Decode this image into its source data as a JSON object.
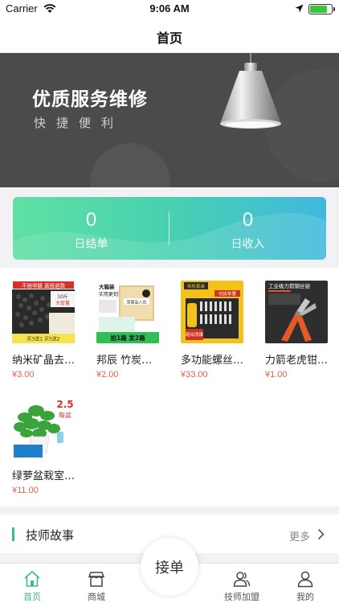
{
  "status_bar": {
    "carrier": "Carrier",
    "time": "9:06 AM",
    "battery_level": 0.85
  },
  "nav": {
    "title": "首页"
  },
  "banner": {
    "headline": "优质服务维修",
    "subline": "快捷便利"
  },
  "stats": {
    "daily_orders": {
      "value": "0",
      "label": "日结单"
    },
    "daily_income": {
      "value": "0",
      "label": "日收入"
    }
  },
  "products": [
    {
      "name": "纳米矿晶去…",
      "price": "¥3.00",
      "img_text": [
        "不除甲醛 直接退款",
        "10斤",
        "大促量",
        "买3送1 买5送2"
      ]
    },
    {
      "name": "邦辰 竹炭…",
      "price": "¥2.00",
      "img_text": [
        "大箱装",
        "实用更划算",
        "家居急入住",
        "拍1箱 发2箱"
      ]
    },
    {
      "name": "多功能螺丝…",
      "price": "¥33.00",
      "img_text": [
        "拆机套装",
        "可拆苹果",
        "组合改锥"
      ]
    },
    {
      "name": "力箭老虎钳…",
      "price": "¥1.00",
      "img_text": [
        "工业级力箭钢丝钳"
      ]
    },
    {
      "name": "绿萝盆栽室…",
      "price": "¥11.00",
      "img_text": [
        "2.5",
        "每盆"
      ]
    }
  ],
  "story": {
    "title": "技师故事",
    "more": "更多"
  },
  "tabbar": {
    "fab_label": "接单",
    "items": [
      {
        "label": "首页"
      },
      {
        "label": "商城"
      },
      {
        "label": "技师加盟"
      },
      {
        "label": "我的"
      }
    ]
  },
  "colors": {
    "accent": "#3cba8f",
    "price": "#e2614d",
    "banner_bg": "#4b4b4b"
  },
  "icons": [
    "wifi-icon",
    "location-icon",
    "battery-icon",
    "lamp-image",
    "chevron-right-icon",
    "home-icon",
    "shop-icon",
    "people-icon",
    "person-icon"
  ]
}
